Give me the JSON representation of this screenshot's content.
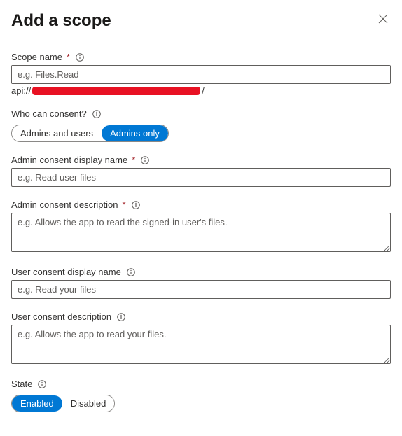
{
  "header": {
    "title": "Add a scope"
  },
  "scopeName": {
    "label": "Scope name",
    "placeholder": "e.g. Files.Read",
    "apiPrefix": "api://",
    "apiSuffix": "/"
  },
  "whoCanConsent": {
    "label": "Who can consent?",
    "options": {
      "adminsAndUsers": "Admins and users",
      "adminsOnly": "Admins only"
    }
  },
  "adminConsentDisplayName": {
    "label": "Admin consent display name",
    "placeholder": "e.g. Read user files"
  },
  "adminConsentDescription": {
    "label": "Admin consent description",
    "placeholder": "e.g. Allows the app to read the signed-in user's files."
  },
  "userConsentDisplayName": {
    "label": "User consent display name",
    "placeholder": "e.g. Read your files"
  },
  "userConsentDescription": {
    "label": "User consent description",
    "placeholder": "e.g. Allows the app to read your files."
  },
  "state": {
    "label": "State",
    "options": {
      "enabled": "Enabled",
      "disabled": "Disabled"
    }
  }
}
